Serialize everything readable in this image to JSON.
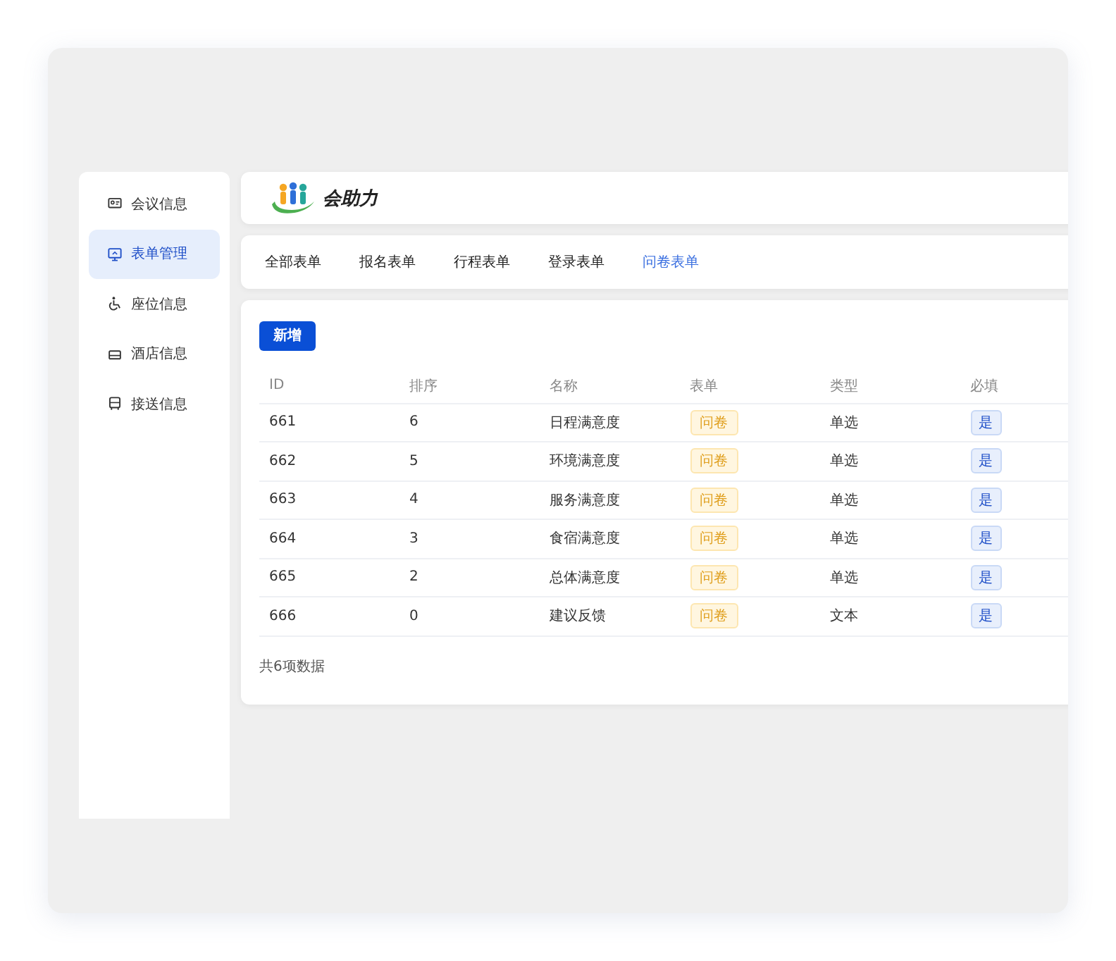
{
  "brand": {
    "name": "会助力"
  },
  "sidebar": {
    "items": [
      {
        "label": "会议信息",
        "selected": false
      },
      {
        "label": "表单管理",
        "selected": true
      },
      {
        "label": "座位信息",
        "selected": false
      },
      {
        "label": "酒店信息",
        "selected": false
      },
      {
        "label": "接送信息",
        "selected": false
      }
    ]
  },
  "tabs": [
    {
      "label": "全部表单",
      "selected": false
    },
    {
      "label": "报名表单",
      "selected": false
    },
    {
      "label": "行程表单",
      "selected": false
    },
    {
      "label": "登录表单",
      "selected": false
    },
    {
      "label": "问卷表单",
      "selected": true
    }
  ],
  "add_button": "新增",
  "table": {
    "columns": [
      "ID",
      "排序",
      "名称",
      "表单",
      "类型",
      "必填"
    ],
    "rows": [
      [
        "661",
        "6",
        "日程满意度",
        "问卷",
        "单选",
        "是"
      ],
      [
        "662",
        "5",
        "环境满意度",
        "问卷",
        "单选",
        "是"
      ],
      [
        "663",
        "4",
        "服务满意度",
        "问卷",
        "单选",
        "是"
      ],
      [
        "664",
        "3",
        "食宿满意度",
        "问卷",
        "单选",
        "是"
      ],
      [
        "665",
        "2",
        "总体满意度",
        "问卷",
        "单选",
        "是"
      ],
      [
        "666",
        "0",
        "建议反馈",
        "问卷",
        "文本",
        "是"
      ]
    ]
  },
  "footer": "共6项数据"
}
